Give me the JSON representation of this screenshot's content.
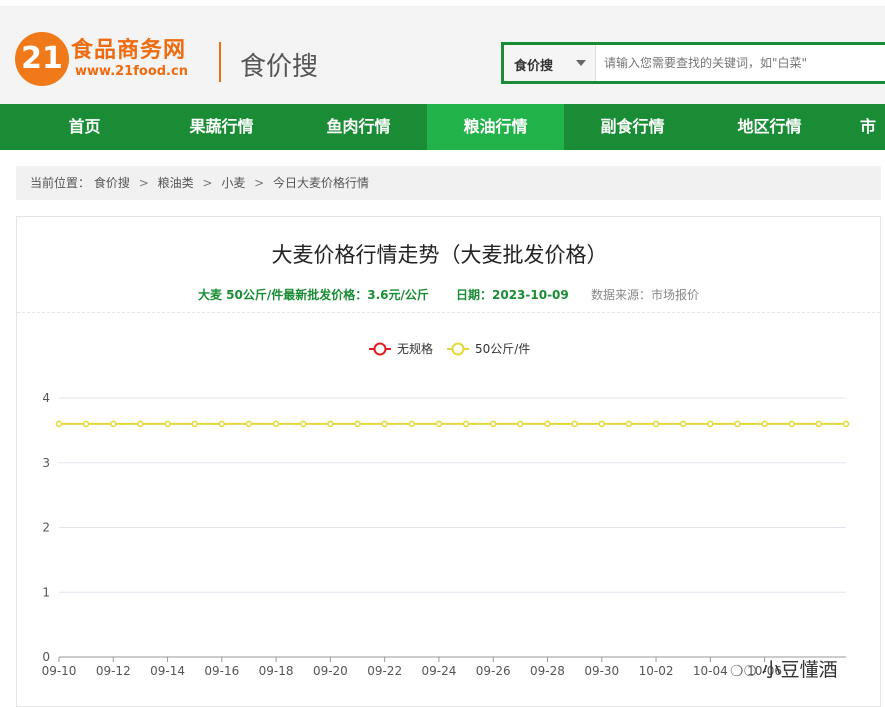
{
  "header": {
    "logo_mark": "21",
    "logo_name": "食品商务网",
    "logo_url": "www.21food.cn",
    "site_sub": "食价搜",
    "search": {
      "select_label": "食价搜",
      "placeholder": "请输入您需要查找的关键词，如\"白菜\""
    }
  },
  "nav": {
    "items": [
      {
        "label": "首页"
      },
      {
        "label": "果蔬行情"
      },
      {
        "label": "鱼肉行情"
      },
      {
        "label": "粮油行情"
      },
      {
        "label": "副食行情"
      },
      {
        "label": "地区行情"
      },
      {
        "label": "市"
      }
    ],
    "active_index": 3
  },
  "breadcrumb": {
    "prefix": "当前位置：",
    "items": [
      "食价搜",
      "粮油类",
      "小麦",
      "今日大麦价格行情"
    ],
    "separator": ">"
  },
  "chart_header": {
    "title": "大麦价格行情走势（大麦批发价格）",
    "latest_price": "大麦 50公斤/件最新批发价格：3.6元/公斤",
    "date": "日期：2023-10-09",
    "source": "数据来源：市场报价"
  },
  "watermark": "小豆懂酒",
  "colors": {
    "brand_green": "#1a8c35",
    "nav_active": "#22b24a",
    "brand_orange": "#ee6b10",
    "series_red": "#e02020",
    "series_yellow": "#e6d83a"
  },
  "chart_data": {
    "type": "line",
    "title": "",
    "xlabel": "",
    "ylabel": "",
    "ylim": [
      0,
      4
    ],
    "yticks": [
      0,
      1,
      2,
      3,
      4
    ],
    "legend_position": "top-center",
    "grid": true,
    "x": [
      "09-10",
      "09-11",
      "09-12",
      "09-13",
      "09-14",
      "09-15",
      "09-16",
      "09-17",
      "09-18",
      "09-19",
      "09-20",
      "09-21",
      "09-22",
      "09-23",
      "09-24",
      "09-25",
      "09-26",
      "09-27",
      "09-28",
      "09-29",
      "09-30",
      "10-01",
      "10-02",
      "10-03",
      "10-04",
      "10-05",
      "10-06",
      "10-07",
      "10-08",
      "10-09"
    ],
    "xtick_labels": [
      "09-10",
      "09-12",
      "09-14",
      "09-16",
      "09-18",
      "09-20",
      "09-22",
      "09-24",
      "09-26",
      "09-28",
      "09-30",
      "10-02",
      "10-04",
      "10-06"
    ],
    "series": [
      {
        "name": "无规格",
        "color": "#e02020",
        "values": []
      },
      {
        "name": "50公斤/件",
        "color": "#e6d83a",
        "values": [
          3.6,
          3.6,
          3.6,
          3.6,
          3.6,
          3.6,
          3.6,
          3.6,
          3.6,
          3.6,
          3.6,
          3.6,
          3.6,
          3.6,
          3.6,
          3.6,
          3.6,
          3.6,
          3.6,
          3.6,
          3.6,
          3.6,
          3.6,
          3.6,
          3.6,
          3.6,
          3.6,
          3.6,
          3.6,
          3.6
        ]
      }
    ]
  }
}
